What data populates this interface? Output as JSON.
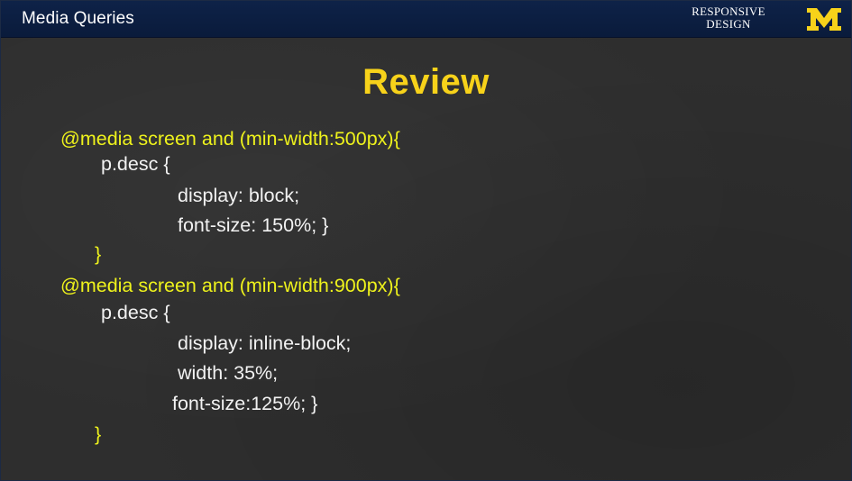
{
  "header": {
    "title": "Media Queries",
    "brand_line1": "RESPONSIVE",
    "brand_line2": "DESIGN",
    "logo_icon": "block-m-logo-icon",
    "logo_color": "#f7d21a",
    "bar_color": "#0e2248"
  },
  "slide": {
    "title": "Review",
    "title_color": "#f7d21a",
    "code": {
      "l1": "@media screen and (min-width:500px){",
      "l2": "p.desc {",
      "l3": "display: block;",
      "l4": "font-size: 150%; }",
      "l5": "}",
      "l6": "@media screen and (min-width:900px){",
      "l7": "p.desc {",
      "l8": "display: inline-block;",
      "l9": "width: 35%;",
      "l10": "font-size:125%; }",
      "l11": "}"
    },
    "code_colors": {
      "media": "#eef21c",
      "rules": "#f2f2f2"
    }
  }
}
